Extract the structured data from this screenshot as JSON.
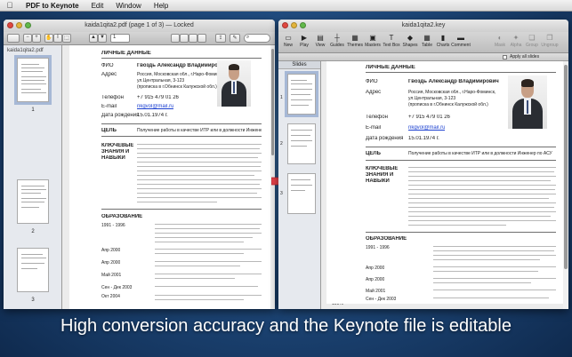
{
  "menubar": {
    "apple": "",
    "items": [
      "PDF to Keynote",
      "Edit",
      "Window",
      "Help"
    ]
  },
  "preview_window": {
    "title": "kaida1qita2.pdf (page 1 of 3) — Locked",
    "page_field": "1",
    "sidebar_title": "kaida1qita2.pdf",
    "thumb_labels": [
      "1",
      "2",
      "3"
    ]
  },
  "keynote_window": {
    "title": "kaida1qita2.key",
    "toolbar": [
      "New",
      "Play",
      "View",
      "Guides",
      "Themes",
      "Masters",
      "Text Box",
      "Shapes",
      "Table",
      "Charts",
      "Comment",
      "Mask",
      "Alpha",
      "Group",
      "Ungroup"
    ],
    "slides_tab": "Slides",
    "zoom": "100%",
    "slide_labels": [
      "1",
      "2",
      "3"
    ],
    "inspector_label": "Apply all slides"
  },
  "resume": {
    "section_personal": "ЛИЧНЫЕ ДАННЫЕ",
    "fio_label": "ФИО",
    "fio_value": "Гвоздь Александр Владимирович",
    "address_label": "Адрес",
    "address_lines": [
      "Россия, Московская обл., г.Наро-Фоминск,",
      "ул.Центральная, 3-123",
      "(прописка в г.Обнинск Калужской обл.)"
    ],
    "phone_label": "Телефон",
    "phone_value": "+7 915 479 01 26",
    "email_label": "E-mail",
    "email_value": "nkgvol@mail.ru",
    "birth_label": "Дата рождения",
    "birth_value": "15.01.1974 г.",
    "goal_label": "ЦЕЛЬ",
    "goal_value": "Получение работы в качестве ИТР или в должности Инженер по АСУ",
    "skills_label_1": "КЛЮЧЕВЫЕ",
    "skills_label_2": "ЗНАНИЯ И",
    "skills_label_3": "НАВЫКИ",
    "education_label": "ОБРАЗОВАНИЕ",
    "edu_years": [
      "1991 - 1996",
      "Апр 2000",
      "Апр 2000",
      "Май 2001",
      "Сен - Дек 2003",
      "Окт 2004"
    ]
  },
  "caption": "High conversion accuracy and the Keynote file is editable",
  "colors": {
    "accent": "#e8424a",
    "link": "#1a3fd0",
    "selection": "#a6b8d6"
  }
}
